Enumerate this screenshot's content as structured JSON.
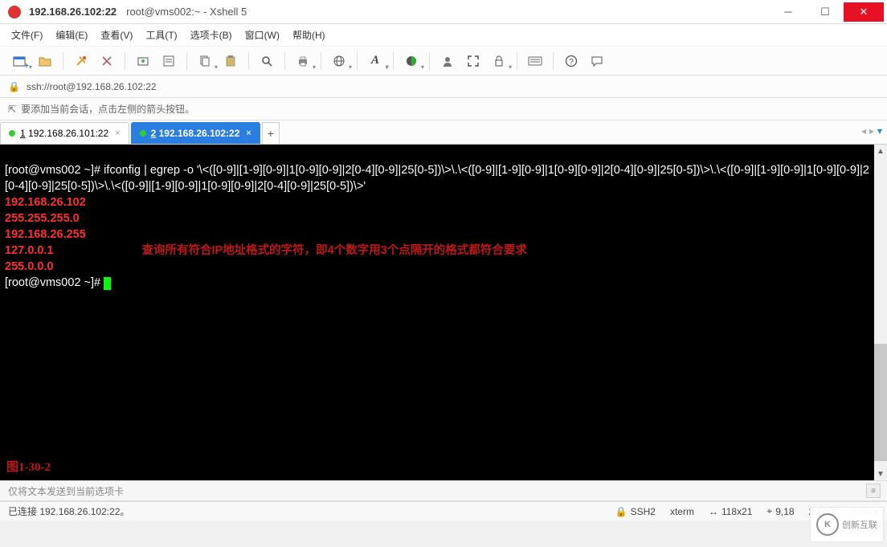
{
  "titlebar": {
    "host": "192.168.26.102:22",
    "title": "root@vms002:~ - Xshell 5"
  },
  "menu": {
    "file": "文件(F)",
    "edit": "编辑(E)",
    "view": "查看(V)",
    "tools": "工具(T)",
    "tabs": "选项卡(B)",
    "window": "窗口(W)",
    "help": "帮助(H)"
  },
  "addressbar": {
    "url": "ssh://root@192.168.26.102:22"
  },
  "tipbar": {
    "text": "要添加当前会话，点击左侧的箭头按钮。"
  },
  "tabs": {
    "items": [
      {
        "num": "1",
        "label": "192.168.26.101:22"
      },
      {
        "num": "2",
        "label": "192.168.26.102:22"
      }
    ],
    "add": "+"
  },
  "terminal": {
    "cmd_line1": "[root@vms002 ~]# ifconfig | egrep -o '\\<([0-9]|[1-9][0-9]|1[0-9][0-9]|2[0-4][0-9]|25[0-5])\\>\\.\\<([0-9]|[1-9][0-9]|1[0-9][0-9]|2[0-4][0-9]|25[0-5])\\>\\.\\<([0-9]|[1-9][0-9]|1[0-9][0-9]|2[0-4][0-9]|25[0-5])\\>\\.\\<([0-9]|[1-9][0-9]|1[0-9][0-9]|2[0-4][0-9]|25[0-5])\\>'",
    "out": [
      "192.168.26.102",
      "255.255.255.0",
      "192.168.26.255",
      "127.0.0.1",
      "255.0.0.0"
    ],
    "prompt2": "[root@vms002 ~]# ",
    "annotation": "查询所有符合IP地址格式的字符，即4个数字用3个点隔开的格式都符合要求",
    "fig": "图1-30-2"
  },
  "sendbar": {
    "placeholder": "仅将文本发送到当前选项卡"
  },
  "status": {
    "conn": "已连接 192.168.26.102:22。",
    "proto": "SSH2",
    "term": "xterm",
    "size": "118x21",
    "pos": "9,18",
    "sessions": "2 会话",
    "caps": "CAP",
    "num": "NUM"
  },
  "watermark": {
    "text": "创新互联"
  }
}
